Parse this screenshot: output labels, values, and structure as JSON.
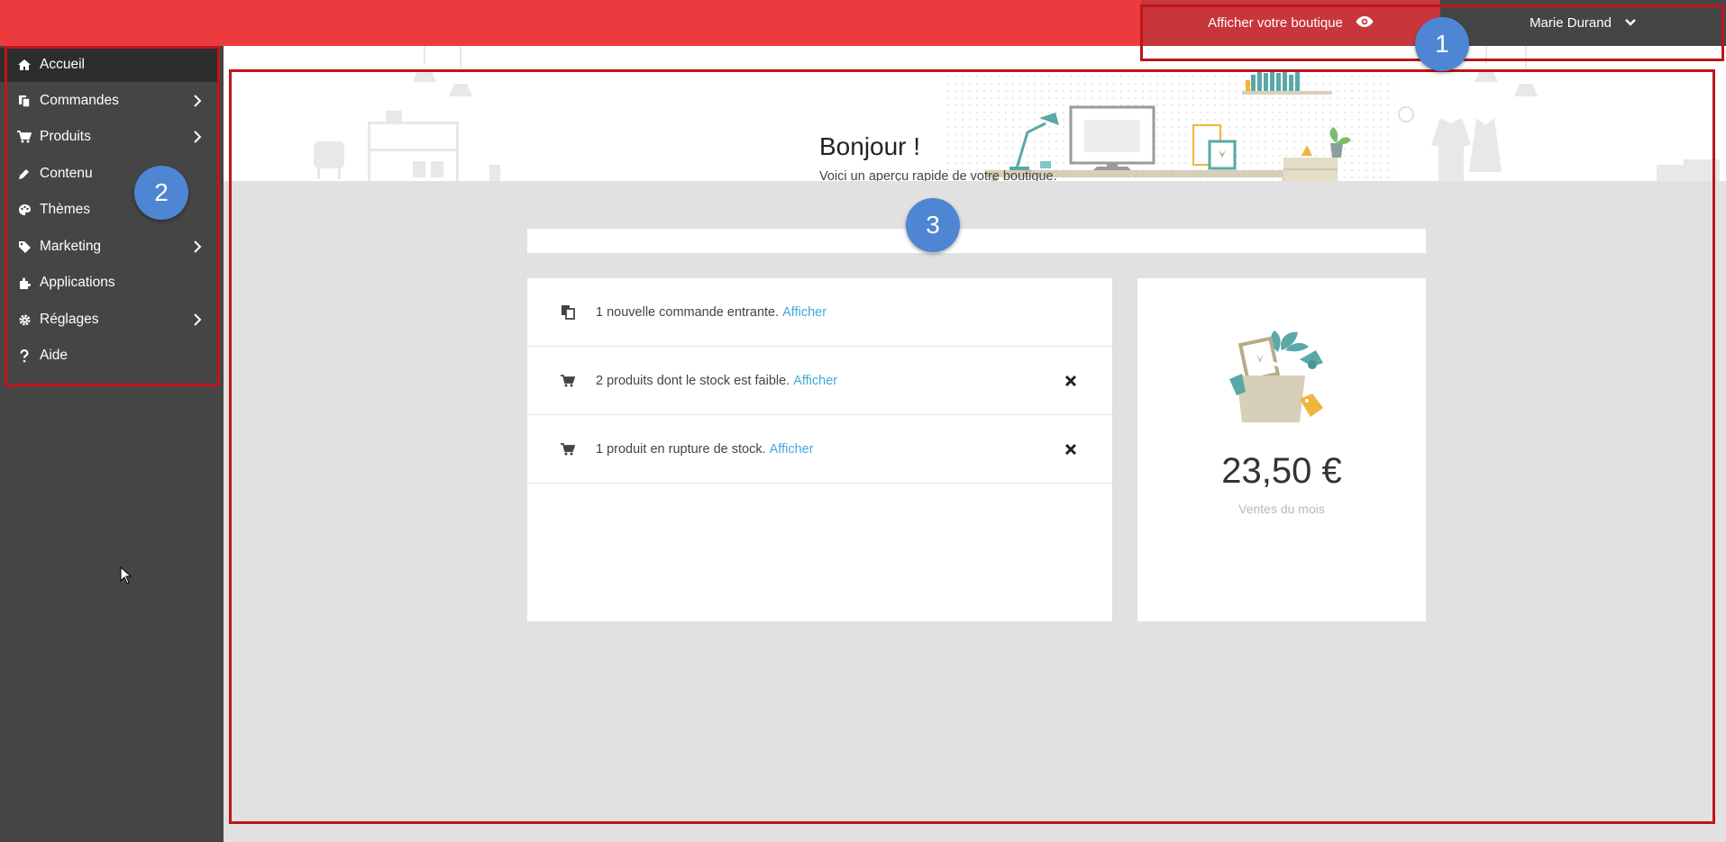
{
  "topbar": {
    "view_shop_label": "Afficher votre boutique",
    "user_name": "Marie Durand"
  },
  "sidebar": {
    "items": [
      {
        "label": "Accueil",
        "icon": "home-icon",
        "has_submenu": false,
        "active": true
      },
      {
        "label": "Commandes",
        "icon": "orders-icon",
        "has_submenu": true
      },
      {
        "label": "Produits",
        "icon": "cart-icon",
        "has_submenu": true
      },
      {
        "label": "Contenu",
        "icon": "pencil-icon",
        "has_submenu": false
      },
      {
        "label": "Thèmes",
        "icon": "palette-icon",
        "has_submenu": false
      },
      {
        "label": "Marketing",
        "icon": "tag-icon",
        "has_submenu": true
      },
      {
        "label": "Applications",
        "icon": "puzzle-icon",
        "has_submenu": false
      },
      {
        "label": "Réglages",
        "icon": "gear-icon",
        "has_submenu": true
      },
      {
        "label": "Aide",
        "icon": "question-icon",
        "has_submenu": false
      }
    ]
  },
  "header": {
    "title": "Bonjour !",
    "subtitle": "Voici un aperçu rapide de votre boutique."
  },
  "alerts": [
    {
      "text": "1 nouvelle commande entrante.",
      "link": "Afficher",
      "icon": "orders-icon",
      "dismissible": false
    },
    {
      "text": "2 produits dont le stock est faible.",
      "link": "Afficher",
      "icon": "cart-icon",
      "dismissible": true
    },
    {
      "text": "1 produit en rupture de stock.",
      "link": "Afficher",
      "icon": "cart-icon",
      "dismissible": true
    }
  ],
  "sales": {
    "amount": "23,50 €",
    "label": "Ventes du mois"
  },
  "annotations": [
    "1",
    "2",
    "3"
  ],
  "colors": {
    "topbar": "#ec3b3f",
    "topbar_dark": "#c8353a",
    "sidebar": "#454545",
    "link": "#3fa9d8",
    "annotation_border": "#c0141c",
    "badge": "#4f86d3"
  }
}
